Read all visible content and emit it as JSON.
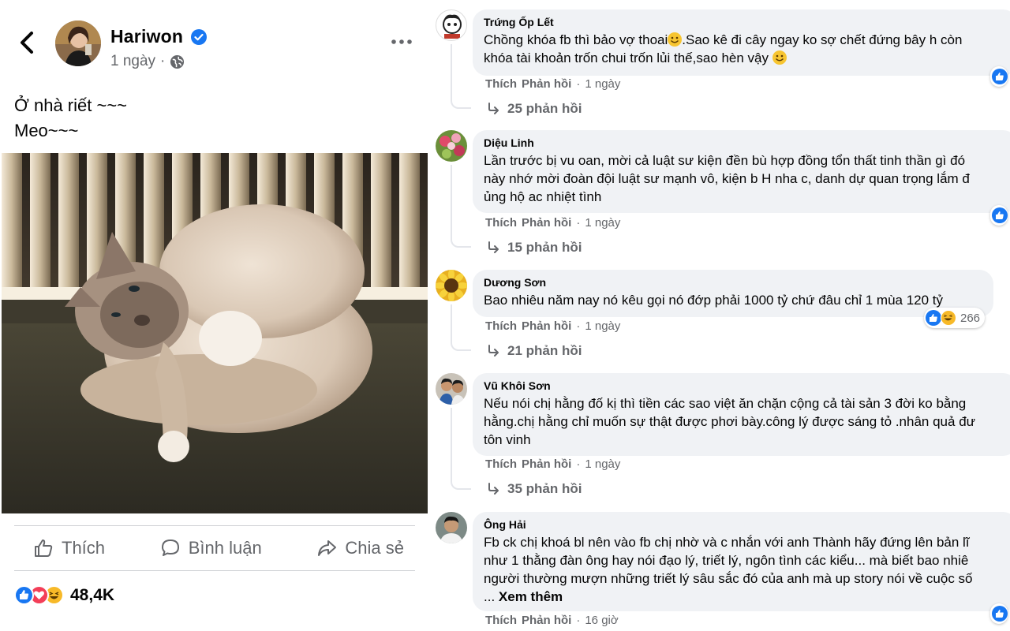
{
  "post": {
    "author": "Hariwon",
    "time": "1 ngày",
    "separator": "·",
    "text_lines": [
      "Ở nhà riết ~~~",
      "Meo~~~"
    ],
    "actions": {
      "like": "Thích",
      "comment": "Bình luận",
      "share": "Chia sẻ"
    },
    "reaction_count": "48,4K",
    "reaction_icons": [
      "like-icon",
      "love-icon",
      "haha-icon"
    ],
    "colors": {
      "like_blue": "#1877f2",
      "love_red": "#f33e58",
      "haha_yellow": "#f7b928",
      "verified_blue": "#1877f2"
    }
  },
  "comments": [
    {
      "name": "Trứng Ốp Lết",
      "lines": [
        "Chồng khóa fb thì bảo vợ thoai",
        ".Sao kê đi cây ngay ko sợ chết đứng bây h còn",
        "khóa tài khoản trốn chui trốn lủi thế,sao hèn vậy"
      ],
      "like": "Thích",
      "reply": "Phản hồi",
      "time": "1 ngày",
      "replies": "25 phản hồi"
    },
    {
      "name": "Diệu Linh",
      "lines": [
        "Lần trước bị vu oan, mời cả luật sư kiện đền bù hợp đồng tổn thất tinh thần gì đó",
        "này nhớ mời đoàn đội luật sư mạnh vô, kiện b H nha c, danh dự quan trọng lắm đ",
        "ủng hộ ac nhiệt tình"
      ],
      "like": "Thích",
      "reply": "Phản hồi",
      "time": "1 ngày",
      "replies": "15 phản hồi"
    },
    {
      "name": "Dương Sơn",
      "lines": [
        "Bao nhiêu năm nay nó kêu gọi nó đớp phải 1000 tỷ chứ đâu chỉ 1 mùa 120 tỷ"
      ],
      "like": "Thích",
      "reply": "Phản hồi",
      "time": "1 ngày",
      "reaction_count": "266",
      "replies": "21 phản hồi"
    },
    {
      "name": "Vũ Khôi Sơn",
      "lines": [
        "Nếu nói chị hằng đố kị thì tiền các sao việt ăn chặn cộng cả tài sản 3 đời ko bằng",
        "hằng.chị hằng chỉ muốn sự thật được phơi bày.công lý được sáng tỏ .nhân quả đư",
        "tôn vinh"
      ],
      "like": "Thích",
      "reply": "Phản hồi",
      "time": "1 ngày",
      "replies": "35 phản hồi"
    },
    {
      "name": "Ông Hải",
      "lines": [
        "Fb ck chị khoá bl nên vào fb chị nhờ và c nhắn với anh Thành hãy đứng lên bản lĩ",
        "như 1 thằng đàn ông hay nói đạo lý, triết lý, ngôn tình các kiểu... mà biết bao nhiê",
        "người thường mượn những triết lý sâu sắc đó của anh mà up story nói về cuộc số"
      ],
      "see_more_prefix": "... ",
      "see_more": "Xem thêm",
      "like": "Thích",
      "reply": "Phản hồi",
      "time": "16 giờ"
    }
  ]
}
